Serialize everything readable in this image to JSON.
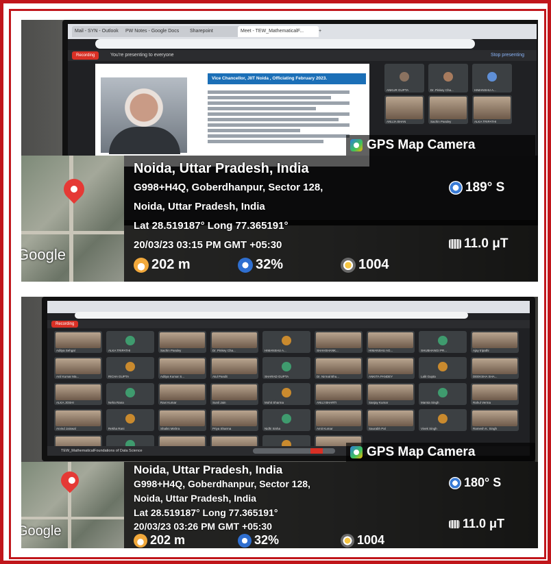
{
  "photos": [
    {
      "browser": {
        "tabs": [
          "Mail - SYN - Outlook",
          "PW Notes - Google Docs",
          "Sharepoint",
          "Meet - TEW_MathematicalF...",
          "+"
        ],
        "active_tab": 3
      },
      "meet": {
        "recording_label": "Recording",
        "presenting_label": "You're presenting to everyone",
        "stop_label": "Stop presenting"
      },
      "slide": {
        "heading": "Vice Chancellor, JIIT Noida , Officiating February 2023."
      },
      "participants": [
        "ANKUR GUPTA",
        "Dr. Pinkey Cha...",
        "HIMANSHU A...",
        "ANUJA BHAN",
        "Sachin Pandey",
        "ALKA TRIPATHI"
      ],
      "gps": {
        "app_title": "GPS Map Camera",
        "logo": "Google",
        "title": "Noida, Uttar Pradesh, India",
        "address_line1": "G998+H4Q, Goberdhanpur, Sector 128,",
        "address_line2": "Noida, Uttar Pradesh, India",
        "latlong": "Lat 28.519187° Long 77.365191°",
        "datetime": "20/03/23 03:15 PM GMT +05:30",
        "heading": "189° S",
        "magnetic": "11.0 μT",
        "altitude": "202 m",
        "humidity": "32%",
        "pressure": "1004"
      }
    },
    {
      "meet": {
        "recording_label": "Recording",
        "footer_label": "TEW_MathematicalFoundations of Data Science"
      },
      "participants": [
        "Aditya Sehgal",
        "ALKA TRIPATHI",
        "Sachin Pandey",
        "Dr. Pinkey Cha...",
        "HIMANSHU A...",
        "SHAHSHANK...",
        "HIMANSHU AG...",
        "SHUBHANGI PR...",
        "Ajay tripathi",
        "Anil Kumar Ma...",
        "RICHA GUPTA",
        "Aditya Kumar S...",
        "Atul Pandit",
        "SHARAD GUPTA",
        "Dr. Nirmal Bhu...",
        "ANKITA PANDEY",
        "Lalit Gupta",
        "DEEKSHA SHA...",
        "ALKA JOSHI",
        "Neha Rana",
        "Ravi Kumar",
        "Sunil Jain",
        "Mohit Sharma",
        "ANUJ BHARTI",
        "Sanjay Kumar",
        "Mamta Singh",
        "Rahul Verma",
        "Arvind Jaiswal",
        "Rekha Rani",
        "Shalini Mishra",
        "Priya Sharma",
        "Nidhi Sinha",
        "Amit Kumar",
        "Saurabh Pal",
        "Vivek Singh",
        "Ramesh K. Singh",
        "Pooja Devi",
        "Deepak Yadav",
        "Anil Gupta",
        "Ritu Jain",
        "Kavita Joshi",
        "Manish Kumar"
      ],
      "gps": {
        "app_title": "GPS Map Camera",
        "logo": "Google",
        "title": "Noida, Uttar Pradesh, India",
        "address_line1": "G998+H4Q, Goberdhanpur, Sector 128,",
        "address_line2": "Noida, Uttar Pradesh, India",
        "latlong": "Lat 28.519187° Long 77.365191°",
        "datetime": "20/03/23 03:26 PM GMT +05:30",
        "heading": "180° S",
        "magnetic": "11.0 μT",
        "altitude": "202 m",
        "humidity": "32%",
        "pressure": "1004"
      }
    }
  ],
  "colors": {
    "frame": "#c0161b",
    "pin": "#e53935",
    "meet_bg": "#202124",
    "tile_bg": "#3c4043"
  },
  "icons": {
    "app": "gps-map-camera-icon",
    "heading": "compass-icon",
    "magnetic": "magnet-icon",
    "altitude": "altitude-icon",
    "humidity": "humidity-icon",
    "pressure": "pressure-gauge-icon"
  }
}
